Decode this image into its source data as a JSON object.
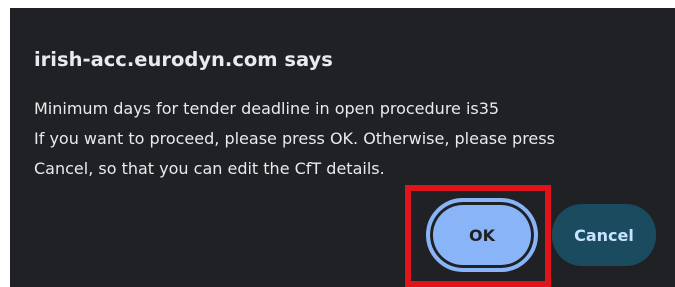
{
  "dialog": {
    "title": "irish-acc.eurodyn.com says",
    "message_lines": [
      "Minimum days for tender deadline in open procedure is35",
      "If you want to proceed, please press OK. Otherwise, please press",
      "Cancel, so that you can edit the CfT details."
    ],
    "ok_label": "OK",
    "cancel_label": "Cancel"
  },
  "colors": {
    "dialog_background": "#202124",
    "text": "#e8eaed",
    "ok_button": "#8ab4f8",
    "cancel_button": "#1a4b5e",
    "highlight": "#e0151b"
  }
}
